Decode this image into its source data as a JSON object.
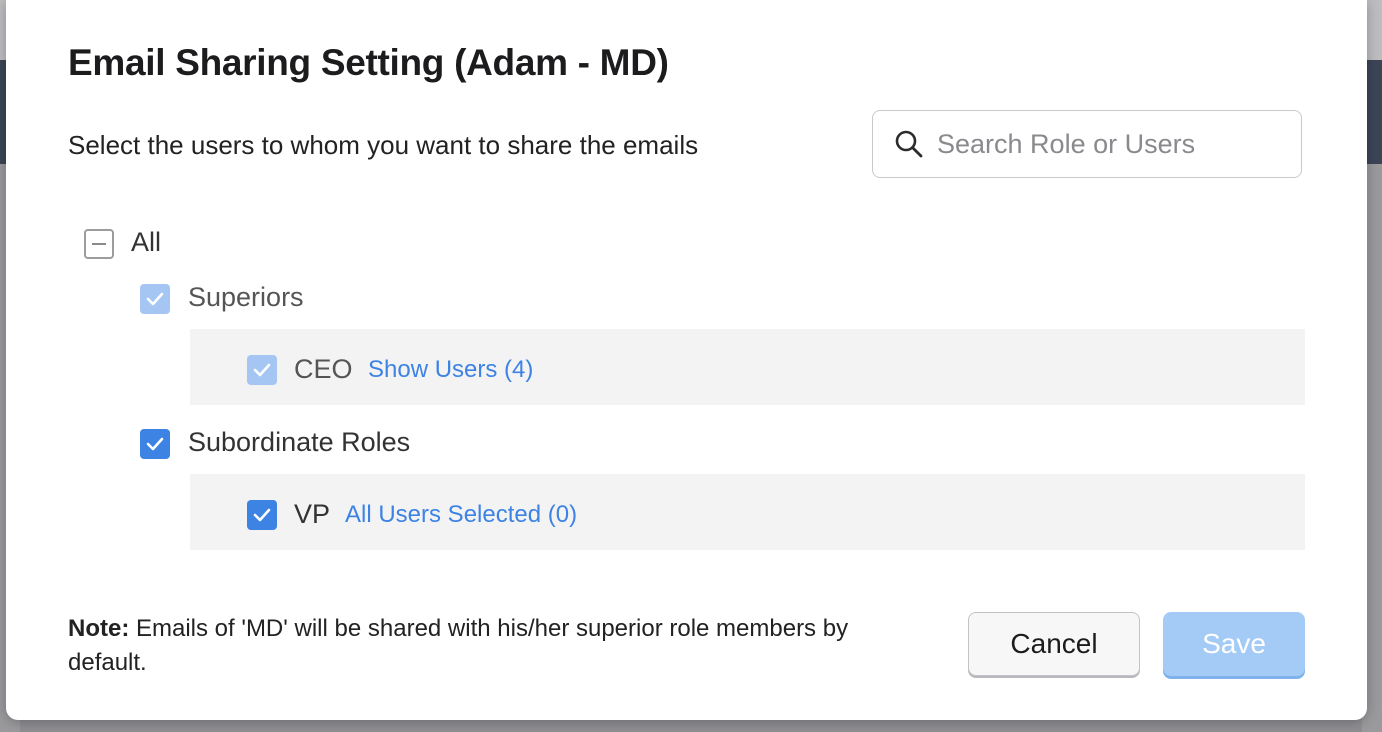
{
  "modal": {
    "title": "Email Sharing Setting (Adam - MD)",
    "subtitle": "Select the users to whom you want to share the emails",
    "search": {
      "placeholder": "Search Role or Users",
      "value": ""
    },
    "tree": {
      "all": {
        "label": "All",
        "state": "indeterminate"
      },
      "superiors": {
        "label": "Superiors",
        "state": "checked-disabled",
        "roles": [
          {
            "name": "CEO",
            "link": "Show Users (4)",
            "state": "checked-disabled"
          }
        ]
      },
      "subordinates": {
        "label": "Subordinate Roles",
        "state": "checked",
        "roles": [
          {
            "name": "VP",
            "link": "All Users Selected (0)",
            "state": "checked"
          }
        ]
      }
    },
    "note": {
      "label": "Note:",
      "text": " Emails of 'MD' will be shared with his/her superior role members by default."
    },
    "buttons": {
      "cancel": "Cancel",
      "save": "Save"
    }
  },
  "colors": {
    "accent": "#3d83e3",
    "accent_disabled": "#a5c6f3",
    "save_disabled": "#a3cbf6",
    "panel_bg": "#f3f3f4"
  }
}
